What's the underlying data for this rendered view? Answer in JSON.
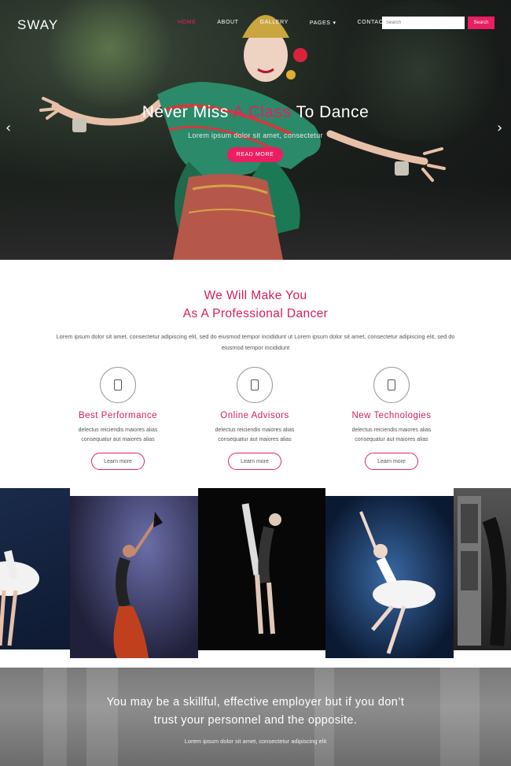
{
  "nav": {
    "logo": "SWAY",
    "items": [
      "HOME",
      "ABOUT",
      "GALLERY",
      "PAGES",
      "CONTACT"
    ],
    "pages_caret": "▾",
    "search_placeholder": "Search",
    "search_button": "Search"
  },
  "hero": {
    "title_before": "Never Miss ",
    "title_highlight": "A Class",
    "title_after": " To Dance",
    "subtitle": "Lorem ipsum dolor sit amet, consectetur",
    "button": "READ MORE",
    "prev_arrow": "‹",
    "next_arrow": "›"
  },
  "about": {
    "heading_line1": "We Will Make You",
    "heading_line2": "As A Professional Dancer",
    "lead": "Lorem ipsum dolor sit amet, consectetur adipiscing elit, sed do eiusmod tempor incididunt ut Lorem ipsum dolor sit amet, consectetur adipiscing elit, sed do eiusmod tempor incididunt",
    "features": [
      {
        "title": "Best Performance",
        "line1": "delectus reiciendis maiores alias",
        "line2": "consequatur aut maiores alias",
        "button": "Learn more"
      },
      {
        "title": "Online Advisors",
        "line1": "delectus reiciendis maiores alias",
        "line2": "consequatur aut maiores alias",
        "button": "Learn more"
      },
      {
        "title": "New Technologies",
        "line1": "delectus reiciendis maiores alias",
        "line2": "consequatur aut maiores alias",
        "button": "Learn more"
      }
    ]
  },
  "quote": {
    "line1": "You may be a skillful, effective employer but if you don’t",
    "line2": "trust your personnel and the opposite.",
    "caption": "Lorem ipsum dolor sit amet, consectetur adipiscing elit"
  },
  "colors": {
    "accent": "#e91e63",
    "heading": "#d81b60"
  }
}
